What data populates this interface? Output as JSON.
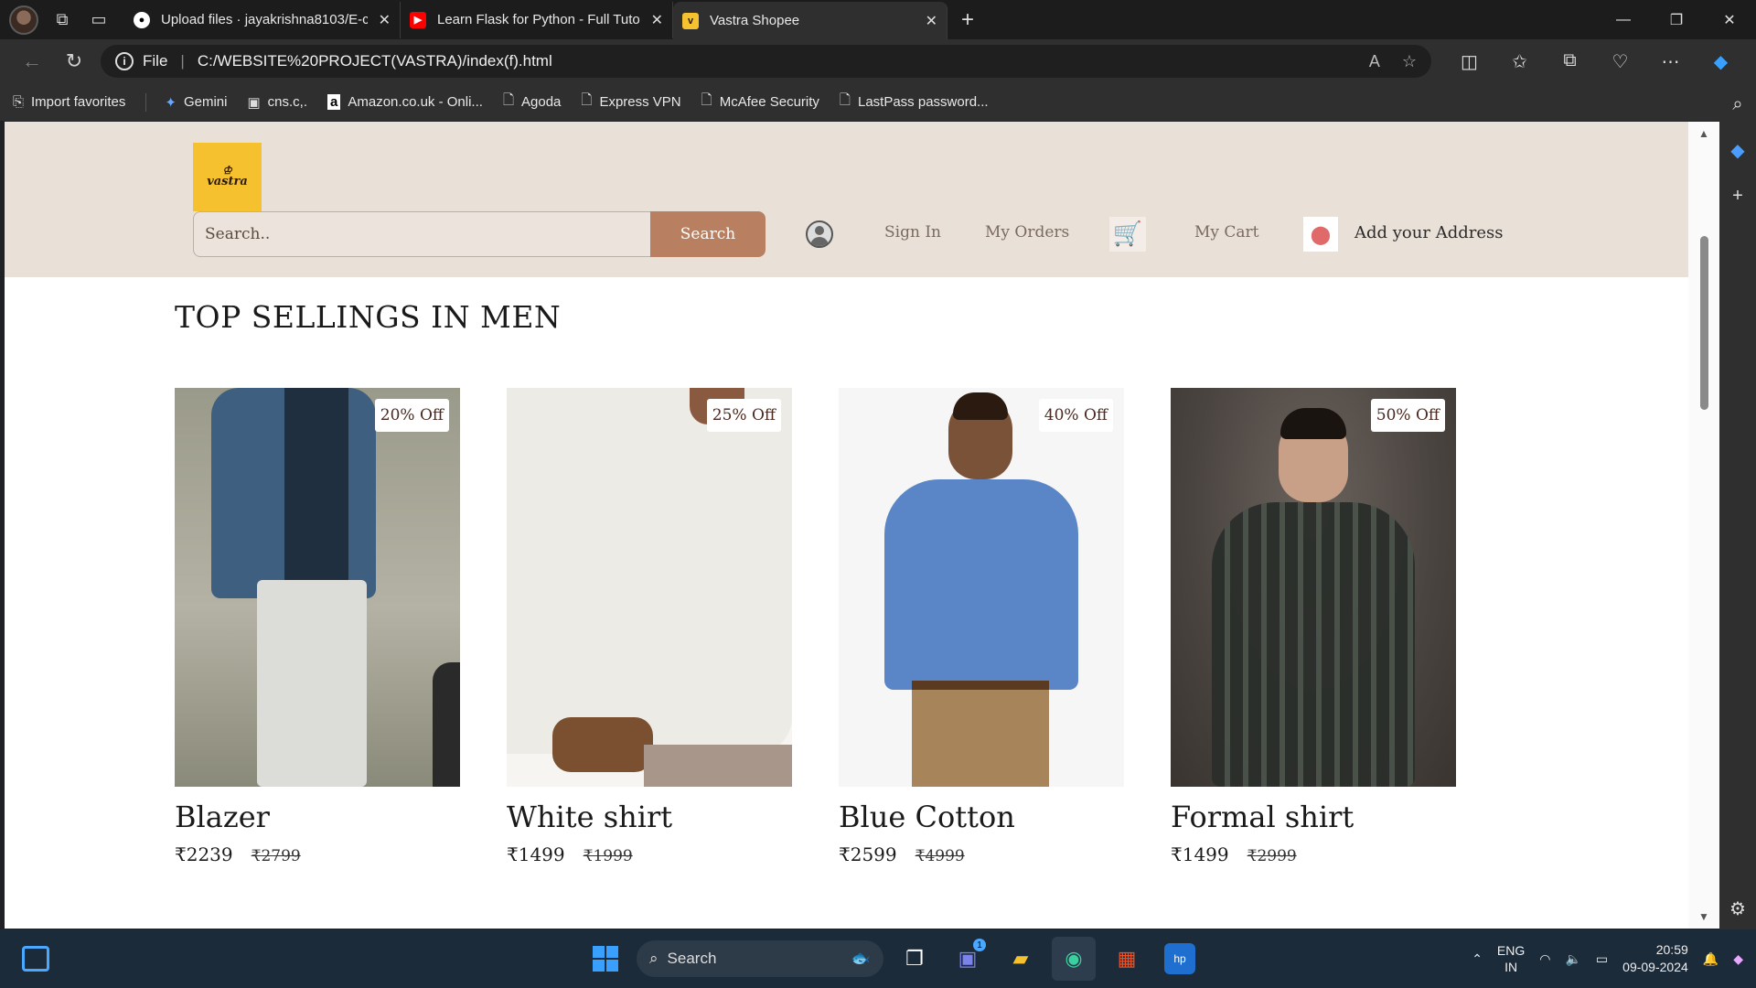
{
  "browser": {
    "tabs": [
      {
        "title": "Upload files · jayakrishna8103/E-c",
        "favicon": "github-icon",
        "active": false
      },
      {
        "title": "Learn Flask for Python - Full Tutor",
        "favicon": "youtube-icon",
        "active": false
      },
      {
        "title": "Vastra Shopee",
        "favicon": "vastra-icon",
        "active": true
      }
    ],
    "address": {
      "scheme_label": "File",
      "url": "C:/WEBSITE%20PROJECT(VASTRA)/index(f).html"
    },
    "favorites": [
      "Import favorites",
      "Gemini",
      "cns.c,.",
      "Amazon.co.uk - Onli...",
      "Agoda",
      "Express VPN",
      "McAfee Security",
      "LastPass password..."
    ]
  },
  "site": {
    "logo_text": "vastra",
    "search": {
      "placeholder": "Search..",
      "button_label": "Search"
    },
    "nav": {
      "sign_in": "Sign In",
      "orders": "My Orders",
      "cart": "My Cart",
      "address": "Add your Address"
    },
    "section_title": "TOP SELLINGS IN MEN",
    "products": [
      {
        "name": "Blazer",
        "badge": "20% Off",
        "price": "₹2239",
        "old_price": "₹2799"
      },
      {
        "name": "White shirt",
        "badge": "25% Off",
        "price": "₹1499",
        "old_price": "₹1999"
      },
      {
        "name": "Blue Cotton",
        "badge": "40% Off",
        "price": "₹2599",
        "old_price": "₹4999"
      },
      {
        "name": "Formal shirt",
        "badge": "50% Off",
        "price": "₹1499",
        "old_price": "₹2999"
      }
    ]
  },
  "taskbar": {
    "search_label": "Search",
    "lang": {
      "line1": "ENG",
      "line2": "IN"
    },
    "time": "20:59",
    "date": "09-09-2024",
    "teams_badge": "1"
  },
  "colors": {
    "header_bg": "#e9e0d8",
    "search_button": "#b88060",
    "logo_bg": "#f5c12e"
  }
}
